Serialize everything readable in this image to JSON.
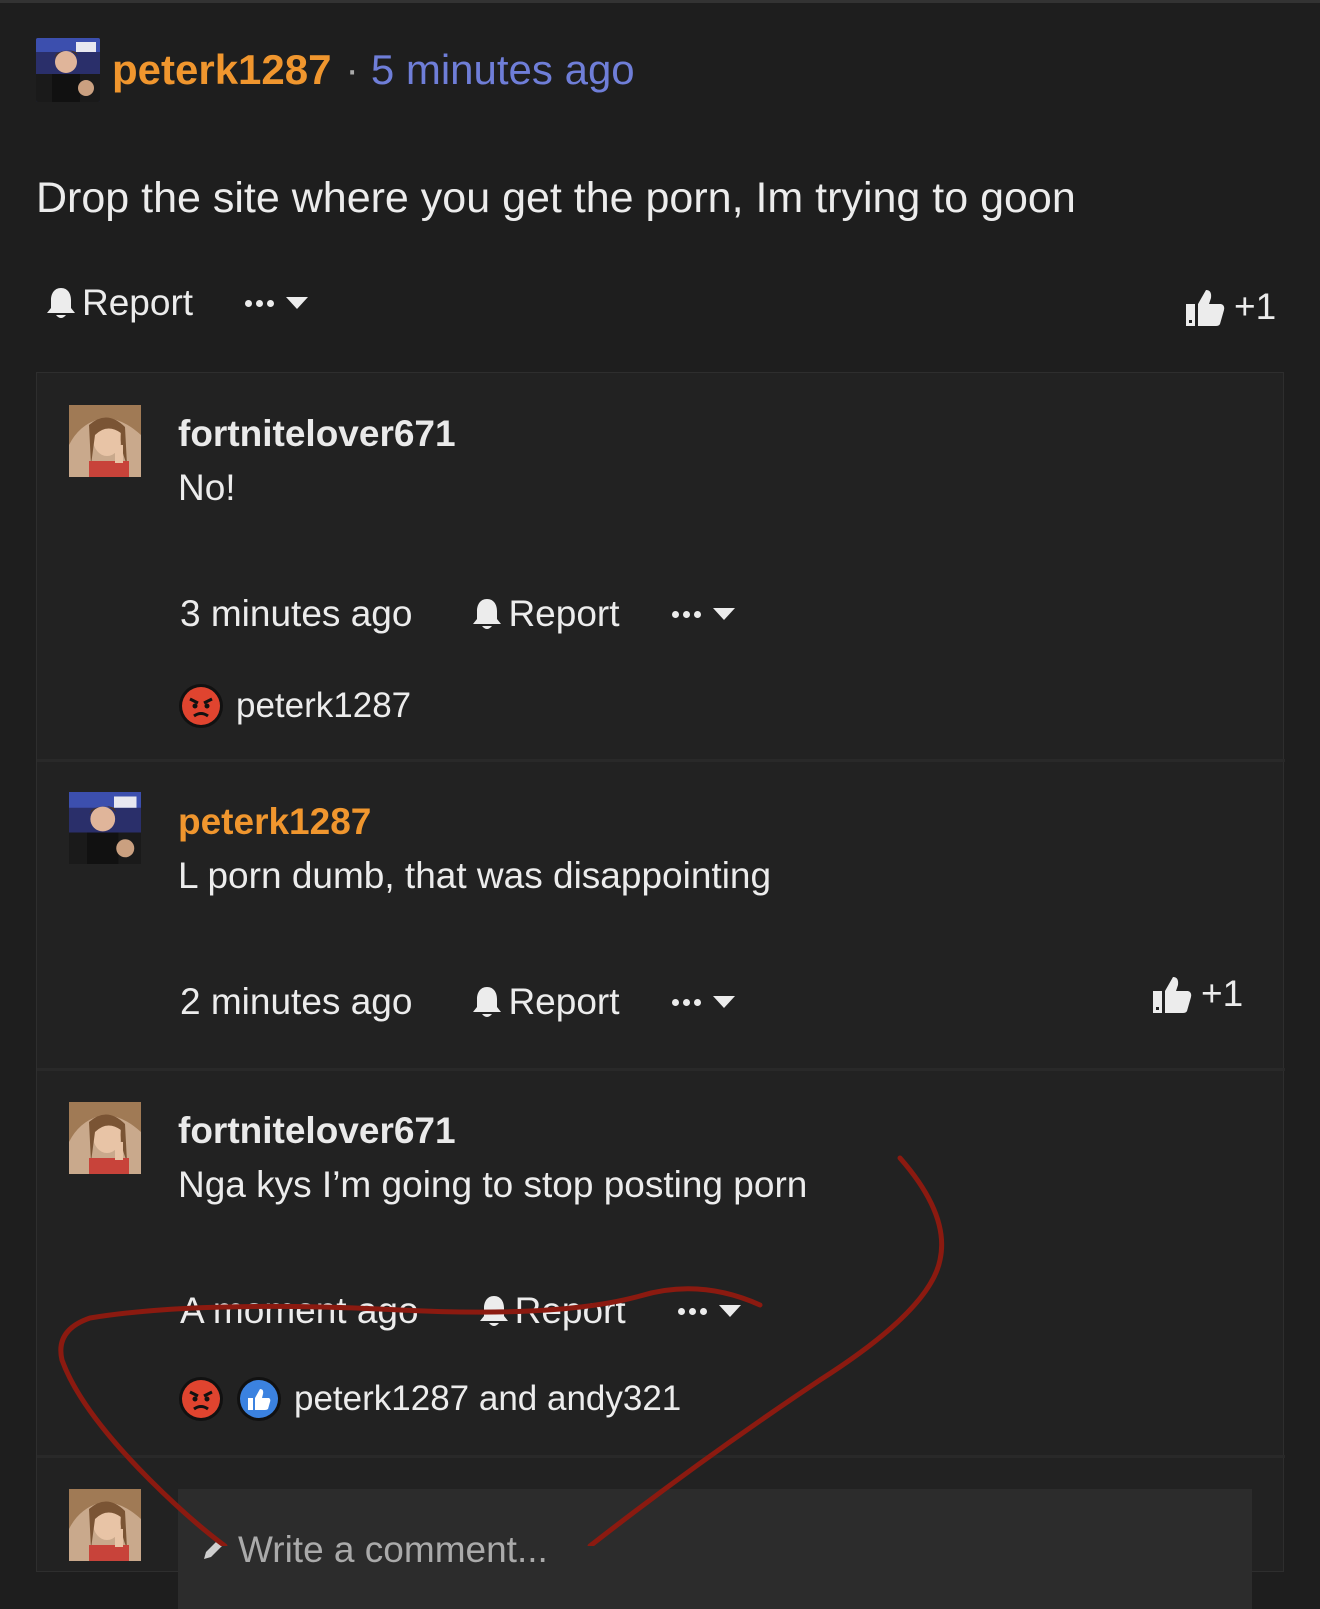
{
  "post": {
    "author": "peterk1287",
    "separator": "·",
    "time": "5 minutes ago",
    "body": "Drop the site where you get the porn, Im trying to goon",
    "report_label": "Report",
    "like_count": "+1"
  },
  "replies": [
    {
      "author": "fortnitelover671",
      "author_color": "#4c5fcf",
      "text": "No!",
      "time": "3 minutes ago",
      "report_label": "Report",
      "reactions": [
        "angry"
      ],
      "reacted_by": "peterk1287"
    },
    {
      "author": "peterk1287",
      "author_color": "#f0962e",
      "text": "L porn dumb, that was disappointing",
      "time": "2 minutes ago",
      "report_label": "Report",
      "like_count": "+1"
    },
    {
      "author": "fortnitelover671",
      "author_color": "#4c5fcf",
      "text": "Nga kys I’m going to stop posting porn",
      "time": "A moment ago",
      "report_label": "Report",
      "reactions": [
        "angry",
        "like"
      ],
      "reacted_by": "peterk1287 and andy321"
    }
  ],
  "composer": {
    "placeholder": "Write a comment..."
  },
  "colors": {
    "background": "#1e1e1e",
    "panel": "#222222",
    "orange_user": "#f0962e",
    "blue_user": "#4c5fcf",
    "timestamp": "#6f7ed8",
    "annotation_red": "#8b1a10"
  },
  "icons": [
    "bell-icon",
    "more-dots-icon",
    "caret-down-icon",
    "thumbs-up-icon",
    "angry-emoji-icon",
    "like-reaction-icon",
    "pencil-icon"
  ]
}
